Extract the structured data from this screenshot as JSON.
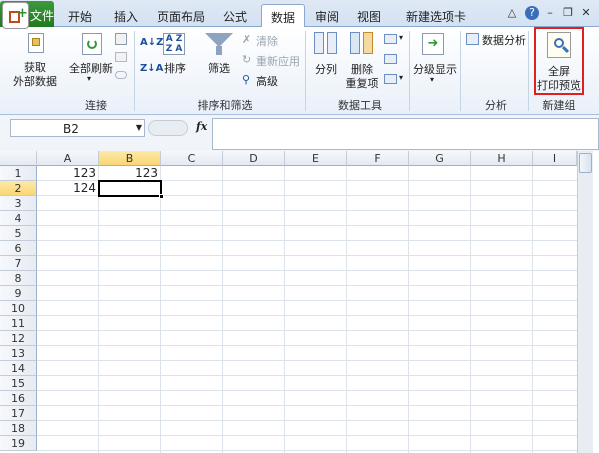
{
  "tabs": {
    "file": "文件",
    "items": [
      "开始",
      "插入",
      "页面布局",
      "公式",
      "数据",
      "审阅",
      "视图",
      "新建选项卡"
    ],
    "active": "数据"
  },
  "ribbon": {
    "connections": {
      "get_external": [
        "获取",
        "外部数据"
      ],
      "refresh_all": "全部刷新",
      "label": "连接"
    },
    "sort_filter": {
      "sort": "排序",
      "filter": "筛选",
      "clear": "清除",
      "reapply": "重新应用",
      "advanced": "高级",
      "label": "排序和筛选"
    },
    "data_tools": {
      "text_to_columns": "分列",
      "remove_duplicates": [
        "删除",
        "重复项"
      ],
      "label": "数据工具"
    },
    "outline": {
      "group_show": "分级显示",
      "label": ""
    },
    "analysis": {
      "data_analysis": "数据分析",
      "label": "分析"
    },
    "new_group": {
      "fullscreen_preview": [
        "全屏",
        "打印预览"
      ],
      "label": "新建组"
    }
  },
  "formula_bar": {
    "name_box": "B2",
    "fx": "fx",
    "value": ""
  },
  "sheet": {
    "columns": [
      "A",
      "B",
      "C",
      "D",
      "E",
      "F",
      "G",
      "H",
      "I"
    ],
    "rows": [
      "1",
      "2",
      "3",
      "4",
      "5",
      "6",
      "7",
      "8",
      "9",
      "10",
      "11",
      "12",
      "13",
      "14",
      "15",
      "16",
      "17",
      "18",
      "19"
    ],
    "selected_column": "B",
    "selected_row": "2",
    "cells": {
      "A1": "123",
      "B1": "123",
      "A2": "124"
    }
  },
  "colors": {
    "highlight": "#e02020",
    "selection_header": "#f9d675",
    "file_tab": "#2a8a2a"
  }
}
